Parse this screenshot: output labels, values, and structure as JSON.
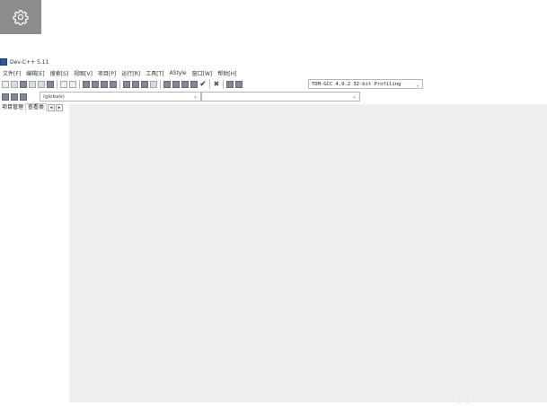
{
  "gear_tile": {
    "icon": "gear-icon",
    "color": "#8c8c8c"
  },
  "window": {
    "title": "Dev-C++ 5.11"
  },
  "menu": [
    "文件[F]",
    "编辑[E]",
    "搜索[S]",
    "视图[V]",
    "项目[P]",
    "运行[R]",
    "工具[T]",
    "AStyle",
    "窗口[W]",
    "帮助[H]"
  ],
  "toolbar": {
    "compiler_select": "TDM-GCC 4.9.2 32-bit Profiling"
  },
  "scope_combo": {
    "value": "(globals)"
  },
  "side_tabs": [
    "项目管理",
    "查看类"
  ],
  "colors": {
    "editor_bg": "#efefef",
    "gear_tile_bg": "#8c8c8c"
  }
}
